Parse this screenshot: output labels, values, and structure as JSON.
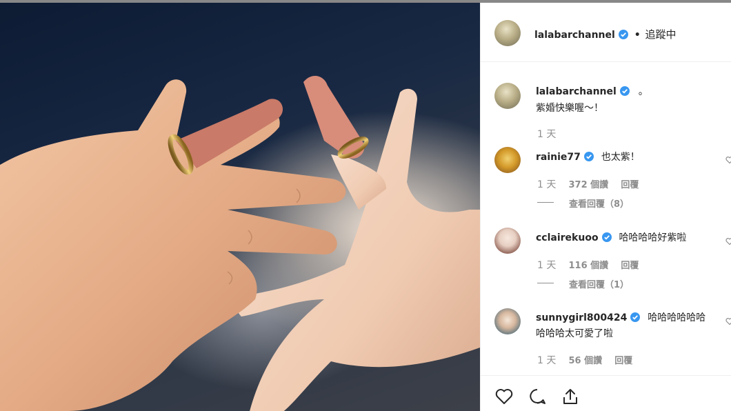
{
  "post": {
    "author": "lalabarchannel",
    "follow_label": "追蹤中",
    "caption_suffix": "。",
    "caption_text": "紫婚快樂喔～！",
    "caption_time": "1 天"
  },
  "comments": [
    {
      "username": "rainie77",
      "text": "也太紫！",
      "time": "1 天",
      "likes": "372 個讚",
      "reply_label": "回覆",
      "view_replies": "查看回覆（8）"
    },
    {
      "username": "cclairekuoo",
      "text": "哈哈哈哈好紫啦",
      "time": "1 天",
      "likes": "116 個讚",
      "reply_label": "回覆",
      "view_replies": "查看回覆（1）"
    },
    {
      "username": "sunnygirl800424",
      "text_line1": "哈哈哈哈哈哈",
      "text_line2": "哈哈哈太可愛了啦",
      "time": "1 天",
      "likes": "56 個讚",
      "reply_label": "回覆"
    }
  ],
  "icons": {
    "verified": "verified-badge-icon",
    "like": "heart-icon",
    "comment": "comment-bubble-icon",
    "share": "share-icon"
  },
  "colors": {
    "verified_blue": "#3897f0",
    "text": "#262626",
    "muted": "#8e8e8e"
  }
}
